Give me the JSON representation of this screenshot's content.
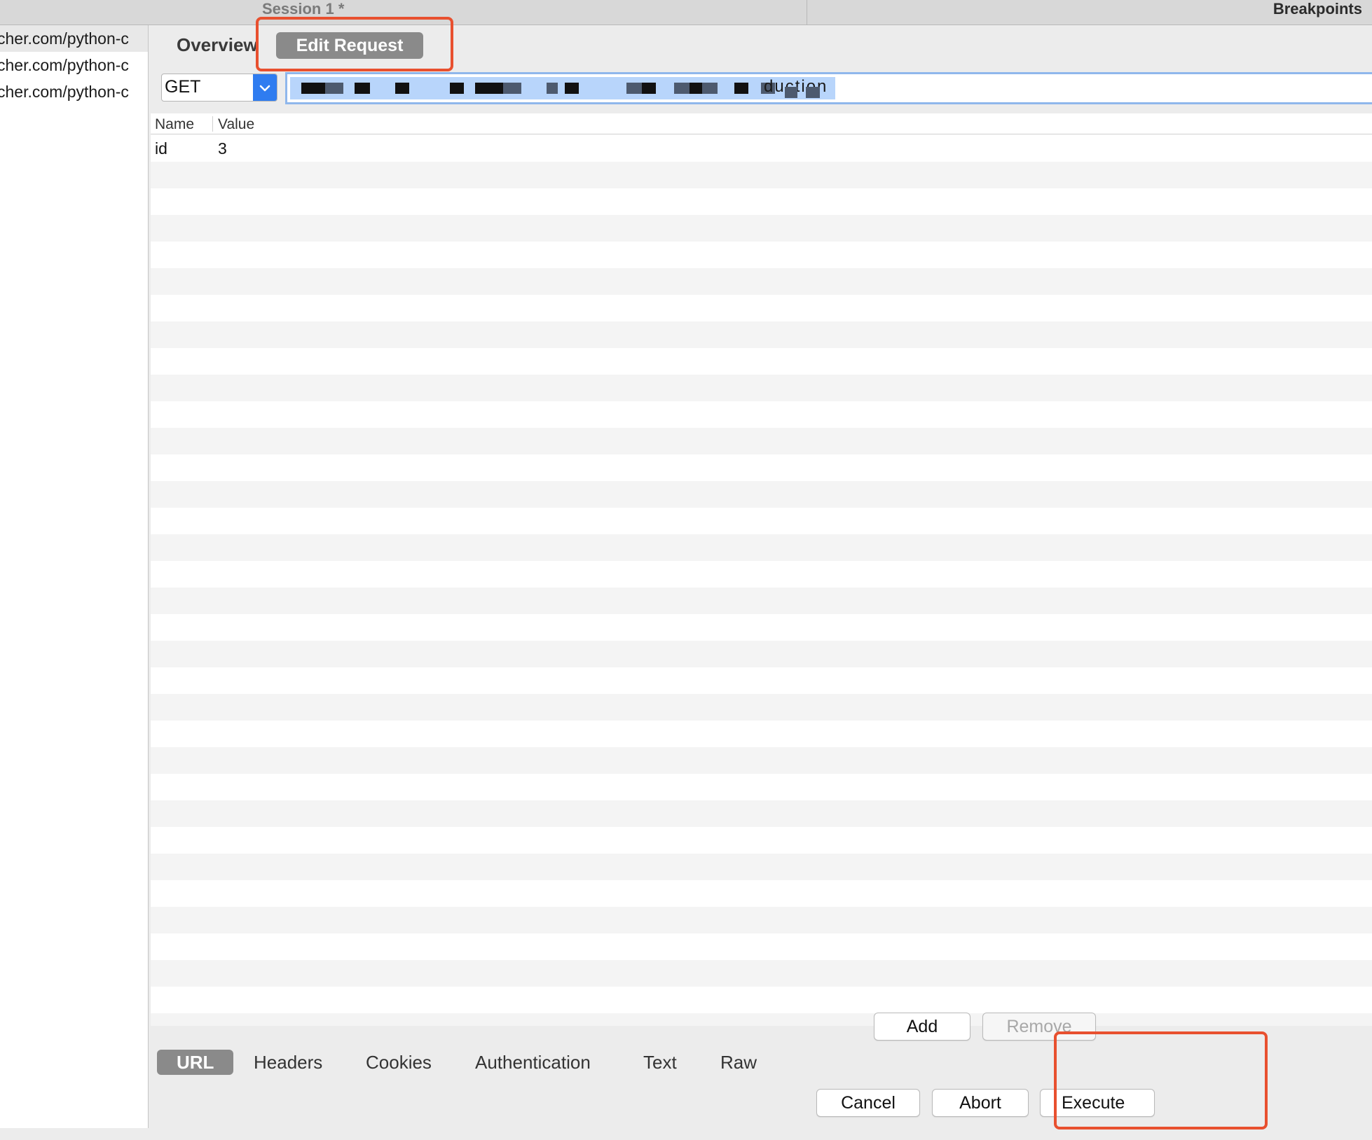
{
  "top_tabs": {
    "session": "Session 1 *",
    "breakpoints": "Breakpoints"
  },
  "left_list": {
    "items": [
      "cher.com/python-c",
      "cher.com/python-c",
      "cher.com/python-c"
    ]
  },
  "view_tabs": {
    "overview": "Overview",
    "edit_request": "Edit Request"
  },
  "request": {
    "method": "GET",
    "url_fragment": "duction"
  },
  "params_table": {
    "headers": {
      "name": "Name",
      "value": "Value"
    },
    "rows": [
      {
        "name": "id",
        "value": "3"
      }
    ]
  },
  "table_buttons": {
    "add": "Add",
    "remove": "Remove"
  },
  "bottom_tabs": {
    "url": "URL",
    "headers": "Headers",
    "cookies": "Cookies",
    "authentication": "Authentication",
    "text": "Text",
    "raw": "Raw"
  },
  "actions": {
    "cancel": "Cancel",
    "abort": "Abort",
    "execute": "Execute"
  },
  "colors": {
    "highlight_box": "#e8502f",
    "select_arrow": "#2f7cf0",
    "url_selection": "#b8d5fb",
    "active_tab": "#8a8a8a"
  }
}
